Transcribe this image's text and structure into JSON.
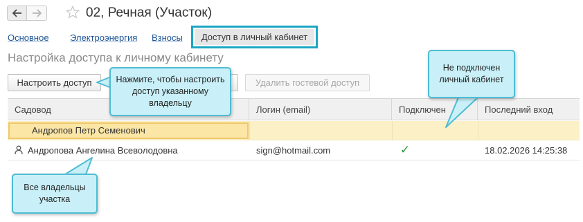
{
  "header": {
    "back_icon": "arrow-left-icon",
    "forward_icon": "arrow-right-icon",
    "favorite_icon": "star-outline-icon",
    "title": "02, Речная (Участок)"
  },
  "tabs": [
    {
      "label": "Основное"
    },
    {
      "label": "Электроэнергия"
    },
    {
      "label": "Взносы"
    },
    {
      "label": "Доступ в личный кабинет",
      "active": true
    }
  ],
  "section_title": "Настройка доступа к личному кабинету",
  "toolbar": {
    "configure_label": "Настроить доступ",
    "delete_guest_label": "Удалить гостевой доступ"
  },
  "table": {
    "columns": [
      "Садовод",
      "Логин (email)",
      "Подключен",
      "Последний вход"
    ],
    "rows": [
      {
        "name": "Андропов Петр Семенович",
        "login": "",
        "connected": "",
        "last_login": "",
        "selected": true
      },
      {
        "name": "Андропова Ангелина Всеволодовна",
        "login": "sign@hotmail.com",
        "connected": "✓",
        "last_login": "18.02.2026 14:25:38",
        "icon": "person-icon"
      }
    ]
  },
  "callouts": {
    "configure_hint": "Нажмите, чтобы настроить доступ указанному владельцу",
    "not_connected": "Не подключен личный кабинет",
    "all_owners": "Все владельцы участка"
  },
  "colors": {
    "accent_frame": "#1aa6c4",
    "callout_bg": "#c9f0f8",
    "selected_row": "#fbf0c6",
    "link": "#1c5596",
    "check": "#2e9a3e"
  }
}
